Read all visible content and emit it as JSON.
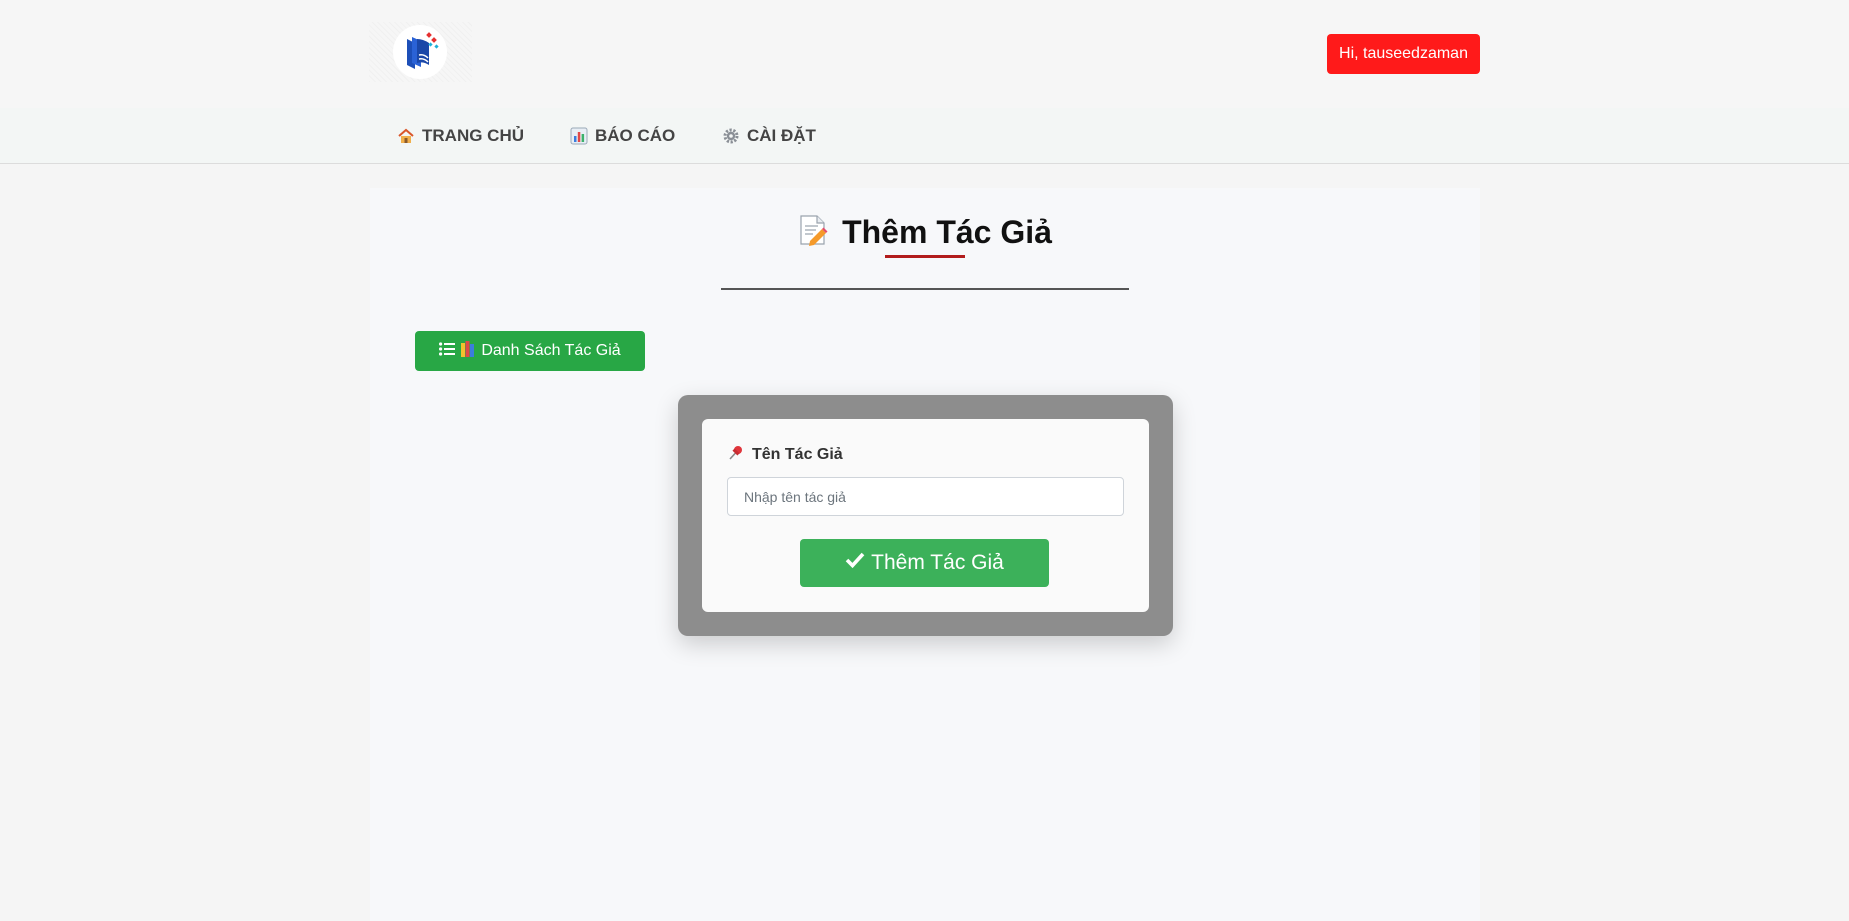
{
  "header": {
    "logo_icon": "book-logo-icon",
    "user_greeting": "Hi, tauseedzaman",
    "user_button_color": "#ff1a1a"
  },
  "nav": {
    "items": [
      {
        "label": "TRANG CHỦ",
        "icon": "house-icon"
      },
      {
        "label": "BÁO CÁO",
        "icon": "bar-chart-icon"
      },
      {
        "label": "CÀI ĐẶT",
        "icon": "gear-icon"
      }
    ]
  },
  "page": {
    "title": "Thêm Tác Giả",
    "title_icon": "memo-icon",
    "accent_color": "#b21c1c"
  },
  "actions": {
    "list_button_label": "Danh Sách Tác Giả",
    "list_button_icons": [
      "list-icon",
      "books-icon"
    ],
    "list_button_color": "#28a745"
  },
  "form": {
    "field_label": "Tên Tác Giả",
    "field_icon": "pushpin-icon",
    "name_input": {
      "value": "",
      "placeholder": "Nhập tên tác giả"
    },
    "submit_label": "Thêm Tác Giả",
    "submit_icon": "checkmark-icon",
    "submit_color": "#3cb15a"
  }
}
